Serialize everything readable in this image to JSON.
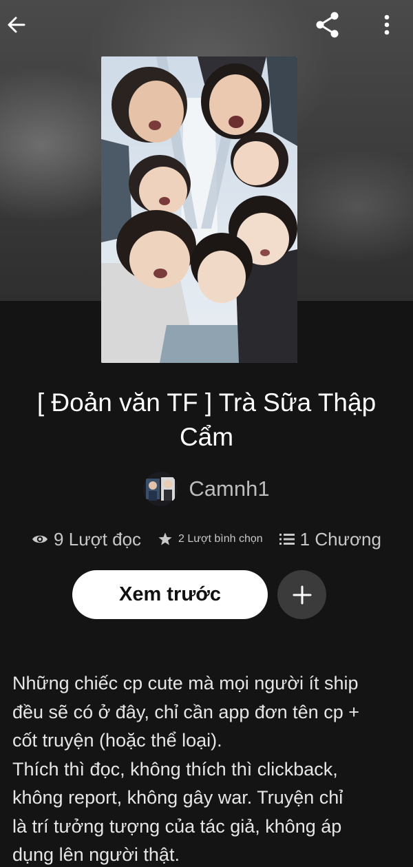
{
  "story": {
    "title": "[ Đoản văn TF ] Trà Sữa Thập Cẩm",
    "author": "Camnh1"
  },
  "stats": {
    "reads": "9 Lượt đọc",
    "votes": "2 Lượt bình chọn",
    "chapters": "1 Chương"
  },
  "actions": {
    "preview_label": "Xem trước"
  },
  "icons": {
    "back": "arrow-left-icon",
    "share": "share-icon",
    "more": "more-vertical-icon",
    "add": "plus-icon",
    "reads": "eye-icon",
    "votes": "star-icon",
    "chapters": "list-icon"
  },
  "description": "Những chiếc cp cute mà mọi người ít ship\nđều sẽ có ở đây, chỉ cần app đơn tên cp +\ncốt truyện (hoặc thể loại).\nThích thì đọc, không thích thì clickback,\nkhông report, không gây war. Truyện chỉ\nlà trí tưởng tượng của tác giả, không áp\ndụng lên người thật.",
  "colors": {
    "background": "#121212",
    "button_primary": "#ffffff",
    "button_secondary": "#3b3b3b",
    "muted_text": "#c8c8c8"
  }
}
